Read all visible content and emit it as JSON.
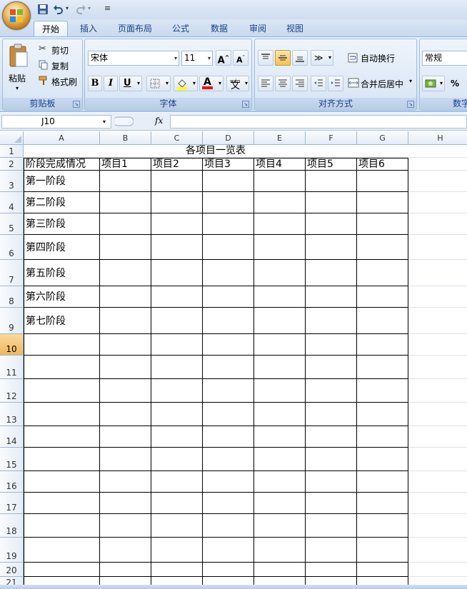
{
  "qat": {
    "save_icon": "save-icon",
    "undo_icon": "undo-icon",
    "redo_icon": "redo-icon",
    "customize_icon": "customize-qat-icon"
  },
  "tabs": [
    "开始",
    "插入",
    "页面布局",
    "公式",
    "数据",
    "审阅",
    "视图"
  ],
  "active_tab": "开始",
  "clipboard": {
    "paste": "粘贴",
    "cut": "剪切",
    "copy": "复制",
    "format_painter": "格式刷",
    "label": "剪贴板"
  },
  "font": {
    "name": "宋体",
    "size": "11",
    "label": "字体",
    "bold": "B",
    "italic": "I",
    "underline": "U",
    "font_color_glyph": "A",
    "grow_glyph": "A",
    "shrink_glyph": "A",
    "phonetic_top": "wén",
    "phonetic_char": "文"
  },
  "alignment": {
    "wrap_text": "自动换行",
    "merge_center": "合并后居中",
    "label": "对齐方式"
  },
  "number": {
    "format": "常规",
    "percent": "%",
    "label": "数字"
  },
  "formula_bar": {
    "name_box": "J10",
    "fx": "fx"
  },
  "colors": {
    "accent": "#15428b",
    "selected_row": "#f1b75a",
    "fill_color": "#ffff00",
    "font_color": "#ff0000"
  },
  "grid": {
    "columns": [
      "A",
      "B",
      "C",
      "D",
      "E",
      "F",
      "G",
      "H"
    ],
    "rows": [
      "1",
      "2",
      "3",
      "4",
      "5",
      "6",
      "7",
      "8",
      "9",
      "10",
      "11",
      "12",
      "13",
      "14",
      "15",
      "16",
      "17",
      "18",
      "19",
      "20",
      "21"
    ],
    "selected_row": "10",
    "title": "各项目一览表",
    "header_row": [
      "阶段完成情况",
      "项目1",
      "项目2",
      "项目3",
      "项目4",
      "项目5",
      "项目6"
    ],
    "stages": [
      "第一阶段",
      "第二阶段",
      "第三阶段",
      "第四阶段",
      "第五阶段",
      "第六阶段",
      "第七阶段"
    ]
  }
}
